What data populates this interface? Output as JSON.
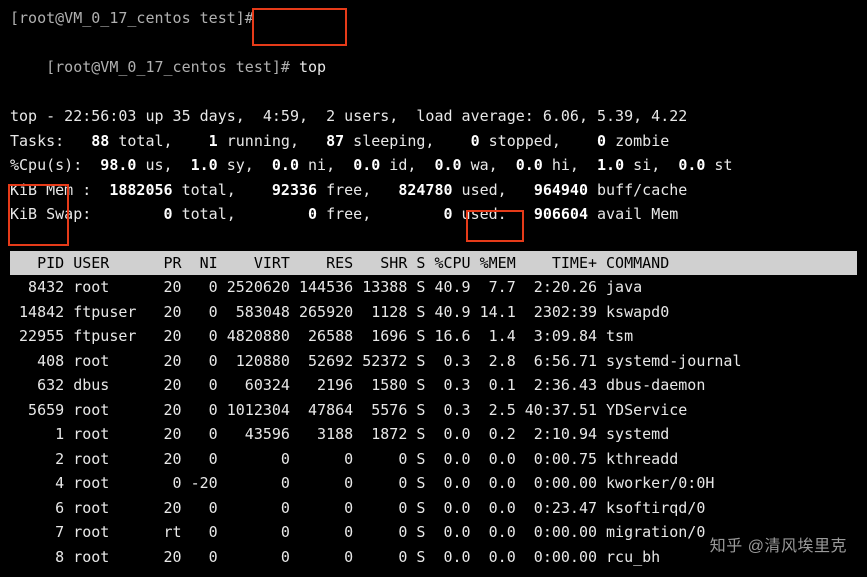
{
  "prompt": {
    "line1": "[root@VM_0_17_centos test]#",
    "line2_prefix": "[root@VM_0_17_centos test]# ",
    "command": "top"
  },
  "summary": {
    "row1": "top - 22:56:03 up 35 days,  4:59,  2 users,  load average: 6.06, 5.39, 4.22",
    "tasks": {
      "label": "Tasks:",
      "total": "88",
      "running": "1",
      "sleeping": "87",
      "stopped": "0",
      "zombie": "0"
    },
    "cpu": {
      "label": "%Cpu(s):",
      "us": "98.0",
      "sy": "1.0",
      "ni": "0.0",
      "id": "0.0",
      "wa": "0.0",
      "hi": "0.0",
      "si": "1.0",
      "st": "0.0"
    },
    "mem": {
      "label": "KiB Mem :",
      "total": "1882056",
      "free": "92336",
      "used": "824780",
      "buff": "964940"
    },
    "swap": {
      "label": "KiB Swap:",
      "total": "0",
      "free": "0",
      "used": "0",
      "avail": "906604"
    }
  },
  "columns": [
    "PID",
    "USER",
    "PR",
    "NI",
    "VIRT",
    "RES",
    "SHR",
    "S",
    "%CPU",
    "%MEM",
    "TIME+",
    "COMMAND"
  ],
  "rows": [
    {
      "pid": "8432",
      "user": "root",
      "pr": "20",
      "ni": "0",
      "virt": "2520620",
      "res": "144536",
      "shr": "13388",
      "s": "S",
      "cpu": "40.9",
      "mem": "7.7",
      "time": "2:20.26",
      "cmd": "java"
    },
    {
      "pid": "14842",
      "user": "ftpuser",
      "pr": "20",
      "ni": "0",
      "virt": "583048",
      "res": "265920",
      "shr": "1128",
      "s": "S",
      "cpu": "40.9",
      "mem": "14.1",
      "time": "2302:39",
      "cmd": "kswapd0"
    },
    {
      "pid": "22955",
      "user": "ftpuser",
      "pr": "20",
      "ni": "0",
      "virt": "4820880",
      "res": "26588",
      "shr": "1696",
      "s": "S",
      "cpu": "16.6",
      "mem": "1.4",
      "time": "3:09.84",
      "cmd": "tsm"
    },
    {
      "pid": "408",
      "user": "root",
      "pr": "20",
      "ni": "0",
      "virt": "120880",
      "res": "52692",
      "shr": "52372",
      "s": "S",
      "cpu": "0.3",
      "mem": "2.8",
      "time": "6:56.71",
      "cmd": "systemd-journal"
    },
    {
      "pid": "632",
      "user": "dbus",
      "pr": "20",
      "ni": "0",
      "virt": "60324",
      "res": "2196",
      "shr": "1580",
      "s": "S",
      "cpu": "0.3",
      "mem": "0.1",
      "time": "2:36.43",
      "cmd": "dbus-daemon"
    },
    {
      "pid": "5659",
      "user": "root",
      "pr": "20",
      "ni": "0",
      "virt": "1012304",
      "res": "47864",
      "shr": "5576",
      "s": "S",
      "cpu": "0.3",
      "mem": "2.5",
      "time": "40:37.51",
      "cmd": "YDService"
    },
    {
      "pid": "1",
      "user": "root",
      "pr": "20",
      "ni": "0",
      "virt": "43596",
      "res": "3188",
      "shr": "1872",
      "s": "S",
      "cpu": "0.0",
      "mem": "0.2",
      "time": "2:10.94",
      "cmd": "systemd"
    },
    {
      "pid": "2",
      "user": "root",
      "pr": "20",
      "ni": "0",
      "virt": "0",
      "res": "0",
      "shr": "0",
      "s": "S",
      "cpu": "0.0",
      "mem": "0.0",
      "time": "0:00.75",
      "cmd": "kthreadd"
    },
    {
      "pid": "4",
      "user": "root",
      "pr": "0",
      "ni": "-20",
      "virt": "0",
      "res": "0",
      "shr": "0",
      "s": "S",
      "cpu": "0.0",
      "mem": "0.0",
      "time": "0:00.00",
      "cmd": "kworker/0:0H"
    },
    {
      "pid": "6",
      "user": "root",
      "pr": "20",
      "ni": "0",
      "virt": "0",
      "res": "0",
      "shr": "0",
      "s": "S",
      "cpu": "0.0",
      "mem": "0.0",
      "time": "0:23.47",
      "cmd": "ksoftirqd/0"
    },
    {
      "pid": "7",
      "user": "root",
      "pr": "rt",
      "ni": "0",
      "virt": "0",
      "res": "0",
      "shr": "0",
      "s": "S",
      "cpu": "0.0",
      "mem": "0.0",
      "time": "0:00.00",
      "cmd": "migration/0"
    },
    {
      "pid": "8",
      "user": "root",
      "pr": "20",
      "ni": "0",
      "virt": "0",
      "res": "0",
      "shr": "0",
      "s": "S",
      "cpu": "0.0",
      "mem": "0.0",
      "time": "0:00.00",
      "cmd": "rcu_bh"
    }
  ],
  "watermark": "知乎 @清风埃里克"
}
